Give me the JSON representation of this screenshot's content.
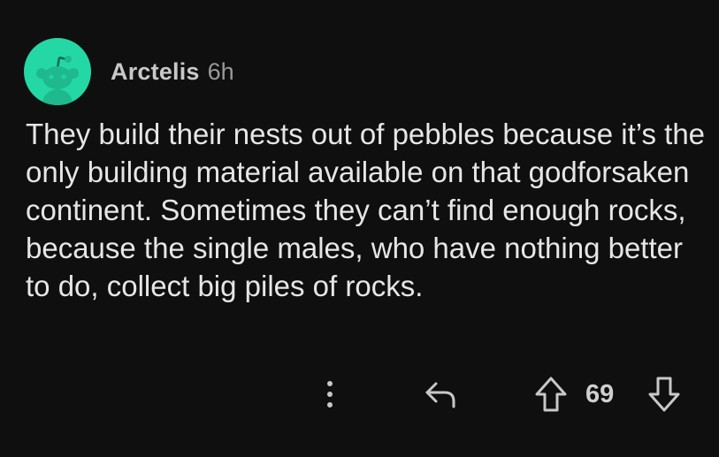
{
  "comment": {
    "author": "Arctelis",
    "age": "6h",
    "body": "They build their nests out of pebbles because it’s the only building material available on that godforsaken continent.  Sometimes they can’t find enough rocks, because the single males, who have nothing better to do, collect big piles of rocks.",
    "score": "69"
  },
  "icons": {
    "avatar": "reddit-snoo-avatar",
    "more": "more-vertical-icon",
    "reply": "reply-arrow-icon",
    "upvote": "upvote-arrow-icon",
    "downvote": "downvote-arrow-icon"
  },
  "colors": {
    "background": "#0f0f10",
    "avatar": "#24d8a6",
    "text": "#e6e6e6",
    "muted": "#9a9a9a"
  }
}
